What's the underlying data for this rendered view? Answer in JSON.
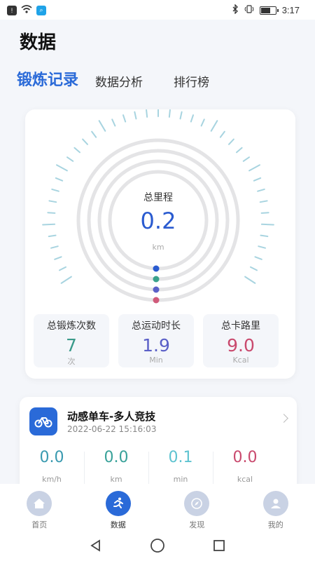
{
  "status_bar": {
    "time": "3:17"
  },
  "page": {
    "title": "数据"
  },
  "tabs": [
    {
      "label": "锻炼记录",
      "active": true
    },
    {
      "label": "数据分析",
      "active": false
    },
    {
      "label": "排行榜",
      "active": false
    }
  ],
  "summary": {
    "label": "总里程",
    "value": "0.2",
    "unit": "km",
    "ring_dot_colors": [
      "#2a5bd0",
      "#3aa28c",
      "#5a60c8",
      "#d05a7a"
    ],
    "tick_color": "#a8d4e0"
  },
  "stats": [
    {
      "title": "总锻炼次数",
      "value": "7",
      "unit": "次",
      "color": "#3a9a8a"
    },
    {
      "title": "总运动时长",
      "value": "1.9",
      "unit": "Min",
      "color": "#5a5fc7"
    },
    {
      "title": "总卡路里",
      "value": "9.0",
      "unit": "Kcal",
      "color": "#c94a6e"
    }
  ],
  "record": {
    "title": "动感单车-多人竞技",
    "time": "2022-06-22 15:16:03",
    "icon": "bike-icon",
    "metrics": [
      {
        "value": "0.0",
        "unit": "km/h",
        "color": "#3a9ab0"
      },
      {
        "value": "0.0",
        "unit": "km",
        "color": "#3aa29a"
      },
      {
        "value": "0.1",
        "unit": "min",
        "color": "#5ec3d0"
      },
      {
        "value": "0.0",
        "unit": "kcal",
        "color": "#c94a6e"
      }
    ]
  },
  "nav": [
    {
      "label": "首页",
      "icon": "home-icon",
      "active": false
    },
    {
      "label": "数据",
      "icon": "run-icon",
      "active": true
    },
    {
      "label": "发现",
      "icon": "compass-icon",
      "active": false
    },
    {
      "label": "我的",
      "icon": "user-icon",
      "active": false
    }
  ]
}
